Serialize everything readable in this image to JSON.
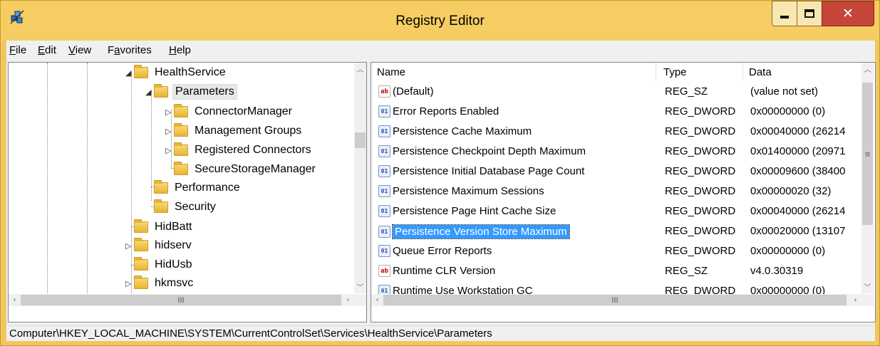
{
  "window": {
    "title": "Registry Editor",
    "accent": "#f6cd62",
    "close_color": "#c7463a"
  },
  "icons": {
    "app": "registry-icon",
    "string": "string-value-icon",
    "binary": "dword-value-icon",
    "folder": "folder-icon"
  },
  "menu": [
    {
      "accel": "F",
      "rest": "ile"
    },
    {
      "accel": "E",
      "rest": "dit"
    },
    {
      "accel": "V",
      "rest": "iew"
    },
    {
      "pre": "F",
      "accel": "a",
      "rest": "vorites"
    },
    {
      "accel": "H",
      "rest": "elp"
    }
  ],
  "tree": {
    "items": [
      {
        "label": "HealthService",
        "expander": "◢"
      },
      {
        "label": "Parameters",
        "expander": "◢"
      },
      {
        "label": "ConnectorManager",
        "expander": "▷"
      },
      {
        "label": "Management Groups",
        "expander": "▷"
      },
      {
        "label": "Registered Connectors",
        "expander": "▷"
      },
      {
        "label": "SecureStorageManager",
        "expander": ""
      },
      {
        "label": "Performance",
        "expander": ""
      },
      {
        "label": "Security",
        "expander": ""
      },
      {
        "label": "HidBatt",
        "expander": ""
      },
      {
        "label": "hidserv",
        "expander": "▷"
      },
      {
        "label": "HidUsb",
        "expander": ""
      },
      {
        "label": "hkmsvc",
        "expander": "▷"
      }
    ],
    "scroll_hscroll_label": "III"
  },
  "list": {
    "columns": [
      "Name",
      "Type",
      "Data"
    ],
    "rows": [
      {
        "name": "(Default)",
        "type": "REG_SZ",
        "data": "(value not set)",
        "kind": "ab"
      },
      {
        "name": "Error Reports Enabled",
        "type": "REG_DWORD",
        "data": "0x00000000 (0)",
        "kind": "bin"
      },
      {
        "name": "Persistence Cache Maximum",
        "type": "REG_DWORD",
        "data": "0x00040000 (26214",
        "kind": "bin"
      },
      {
        "name": "Persistence Checkpoint Depth Maximum",
        "type": "REG_DWORD",
        "data": "0x01400000 (20971",
        "kind": "bin"
      },
      {
        "name": "Persistence Initial Database Page Count",
        "type": "REG_DWORD",
        "data": "0x00009600 (38400",
        "kind": "bin"
      },
      {
        "name": "Persistence Maximum Sessions",
        "type": "REG_DWORD",
        "data": "0x00000020 (32)",
        "kind": "bin"
      },
      {
        "name": "Persistence Page Hint Cache Size",
        "type": "REG_DWORD",
        "data": "0x00040000 (26214",
        "kind": "bin"
      },
      {
        "name": "Persistence Version Store Maximum",
        "type": "REG_DWORD",
        "data": "0x00020000 (13107",
        "kind": "bin"
      },
      {
        "name": "Queue Error Reports",
        "type": "REG_DWORD",
        "data": "0x00000000 (0)",
        "kind": "bin"
      },
      {
        "name": "Runtime CLR Version",
        "type": "REG_SZ",
        "data": "v4.0.30319",
        "kind": "ab"
      },
      {
        "name": "Runtime Use Workstation GC",
        "type": "REG_DWORD",
        "data": "0x00000000 (0)",
        "kind": "bin"
      }
    ],
    "selected_index": 7,
    "hscroll_label": "III",
    "vscroll_grip": "≡"
  },
  "status": {
    "path": "Computer\\HKEY_LOCAL_MACHINE\\SYSTEM\\CurrentControlSet\\Services\\HealthService\\Parameters"
  }
}
